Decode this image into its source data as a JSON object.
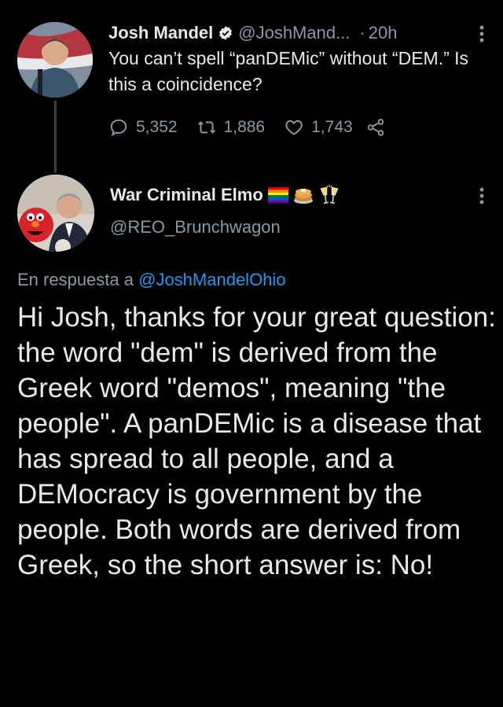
{
  "tweet1": {
    "author_name": "Josh Mandel",
    "handle": "@JoshMand...",
    "separator": "·",
    "time": "20h",
    "text": "You can’t spell “panDEMic” without “DEM.” Is this a coincidence?",
    "icons": {
      "verified": "verified-badge-icon",
      "more": "more-vertical-icon"
    },
    "actions": {
      "replies": "5,352",
      "retweets": "1,886",
      "likes": "1,743"
    }
  },
  "tweet2": {
    "author_name": "War Criminal Elmo",
    "handle": "@REO_Brunchwagon",
    "emojis": [
      "rainbow-flag-icon",
      "pancakes-icon",
      "champagne-toast-icon"
    ],
    "reply_prefix": "En respuesta a",
    "reply_to": "@JoshMandelOhio",
    "text": "Hi Josh, thanks for your great question: the word \"dem\" is derived from the Greek word \"demos\", meaning \"the people\". A panDEMic is a disease that has spread to all people, and a DEMocracy is government by the people. Both words are derived from Greek, so the short answer is: No!"
  },
  "colors": {
    "background": "#000000",
    "text_primary": "#e7e9ea",
    "text_secondary": "#8b98a5",
    "link": "#1d9bf0",
    "verified": "#1d9bf0"
  }
}
